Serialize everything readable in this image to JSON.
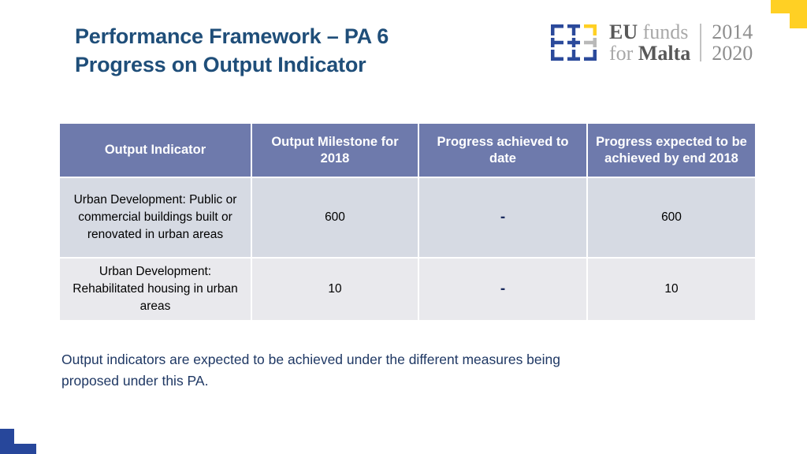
{
  "slide": {
    "title_line1": "Performance Framework – PA 6",
    "title_line2": "Progress on Output Indicator",
    "title_color": "#1f4e79"
  },
  "logo": {
    "mark_name": "eu-funds-grid-mark",
    "word_line1_strong": "EU",
    "word_line1_light": "funds",
    "word_line2_light": "for",
    "word_line2_strong": "Malta",
    "year_start": "2014",
    "year_end": "2020",
    "colors": {
      "blue": "#2b4a9b",
      "yellow": "#ffd024",
      "grey": "#b9b9b9",
      "text_strong": "#585858",
      "text_light": "#a8a8a8",
      "years": "#8e8e8e"
    }
  },
  "decorations": {
    "top_right_color": "#ffd024",
    "bottom_left_color": "#27479b"
  },
  "table": {
    "header_bg": "#6e7aac",
    "row_bg_a": "#d6dae3",
    "row_bg_b": "#e9e9ed",
    "columns": [
      "Output Indicator",
      "Output Milestone for 2018",
      "Progress achieved to date",
      "Progress expected to be achieved by end 2018"
    ],
    "rows": [
      {
        "indicator": "Urban Development: Public or commercial buildings built or renovated in urban areas",
        "milestone_2018": "600",
        "progress_to_date": "-",
        "progress_expected_2018": "600"
      },
      {
        "indicator": "Urban Development: Rehabilitated housing in urban areas",
        "milestone_2018": "10",
        "progress_to_date": "-",
        "progress_expected_2018": "10"
      }
    ]
  },
  "footnote": {
    "line1": "Output indicators are expected to be achieved under the different measures being",
    "line2": "proposed under this PA."
  }
}
